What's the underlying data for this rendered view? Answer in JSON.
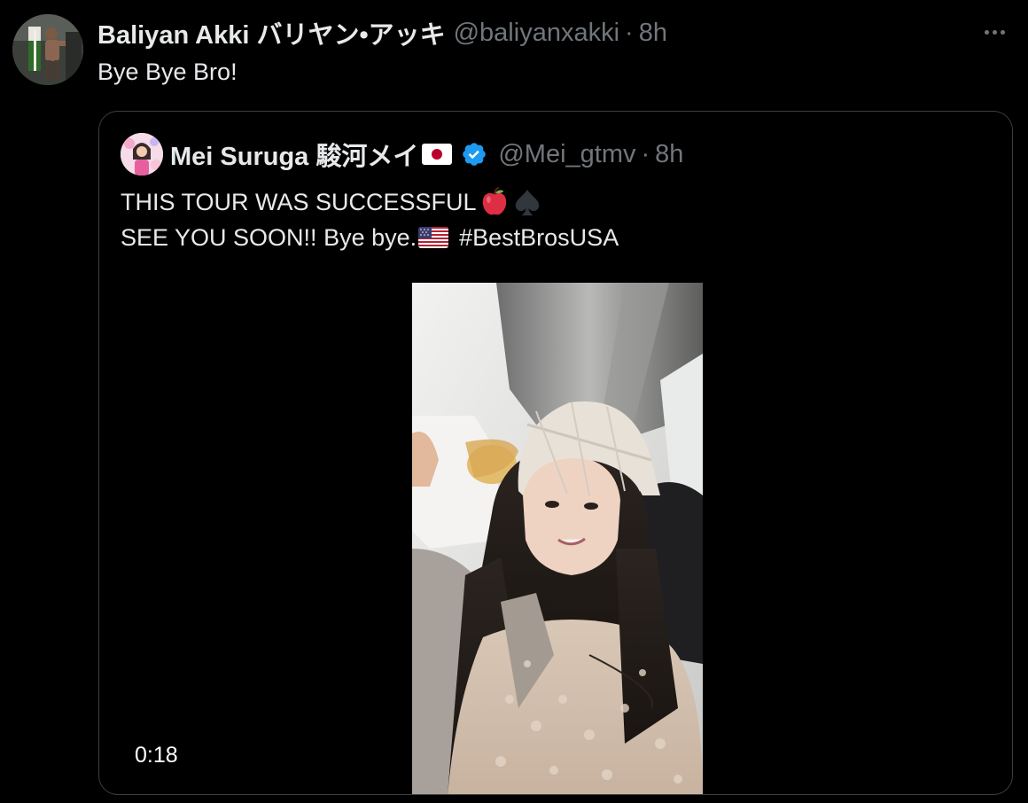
{
  "tweet": {
    "author": {
      "display_name": "Baliyan Akki バリヤン•アッキ",
      "handle": "@baliyanxakki",
      "avatar_icon": "avatar-image"
    },
    "separator": "·",
    "time": "8h",
    "text": "Bye Bye Bro!",
    "more_icon": "more-horizontal-icon"
  },
  "quoted_tweet": {
    "author": {
      "display_name": "Mei Suruga 駿河メイ",
      "handle": "@Mei_gtmv",
      "verified": true,
      "name_emoji": "japan-flag",
      "avatar_icon": "avatar-image"
    },
    "separator": "·",
    "time": "8h",
    "text_line1": "THIS TOUR WAS SUCCESSFUL",
    "text_line1_emojis": [
      "red-apple",
      "spade-suit"
    ],
    "text_line2": "SEE YOU SOON!! Bye bye.",
    "text_line2_emoji": "us-flag",
    "hashtag": "#BestBrosUSA",
    "media": {
      "type": "video",
      "duration": "0:18"
    }
  },
  "colors": {
    "background": "#000000",
    "text_primary": "#e7e9ea",
    "text_secondary": "#71767b",
    "border": "#3a3f44",
    "verified_blue": "#1d9bf0"
  }
}
